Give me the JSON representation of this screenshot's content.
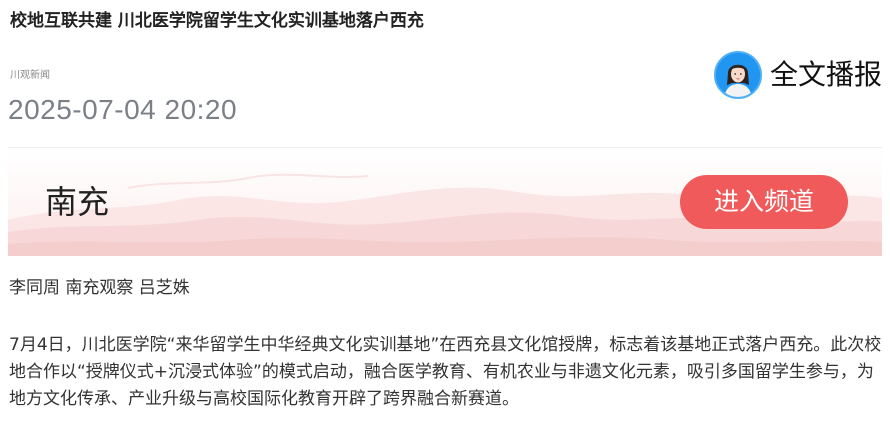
{
  "article": {
    "title": "校地互联共建 川北医学院留学生文化实训基地落户西充",
    "source": "川观新闻",
    "datetime": "2025-07-04 20:20",
    "byline": "李同周 南充观察 吕芝姝",
    "paragraph": "7月4日，川北医学院“来华留学生中华经典文化实训基地”在西充县文化馆授牌，标志着该基地正式落户西充。此次校地合作以“授牌仪式+沉浸式体验”的模式启动，融合医学教育、有机农业与非遗文化元素，吸引多国留学生参与，为地方文化传承、产业升级与高校国际化教育开辟了跨界融合新赛道。"
  },
  "listen": {
    "label": "全文播报",
    "icon": "ai-anchor-avatar-icon"
  },
  "channel": {
    "name": "南充",
    "enter_label": "进入频道",
    "button_color": "#f05a5b"
  }
}
